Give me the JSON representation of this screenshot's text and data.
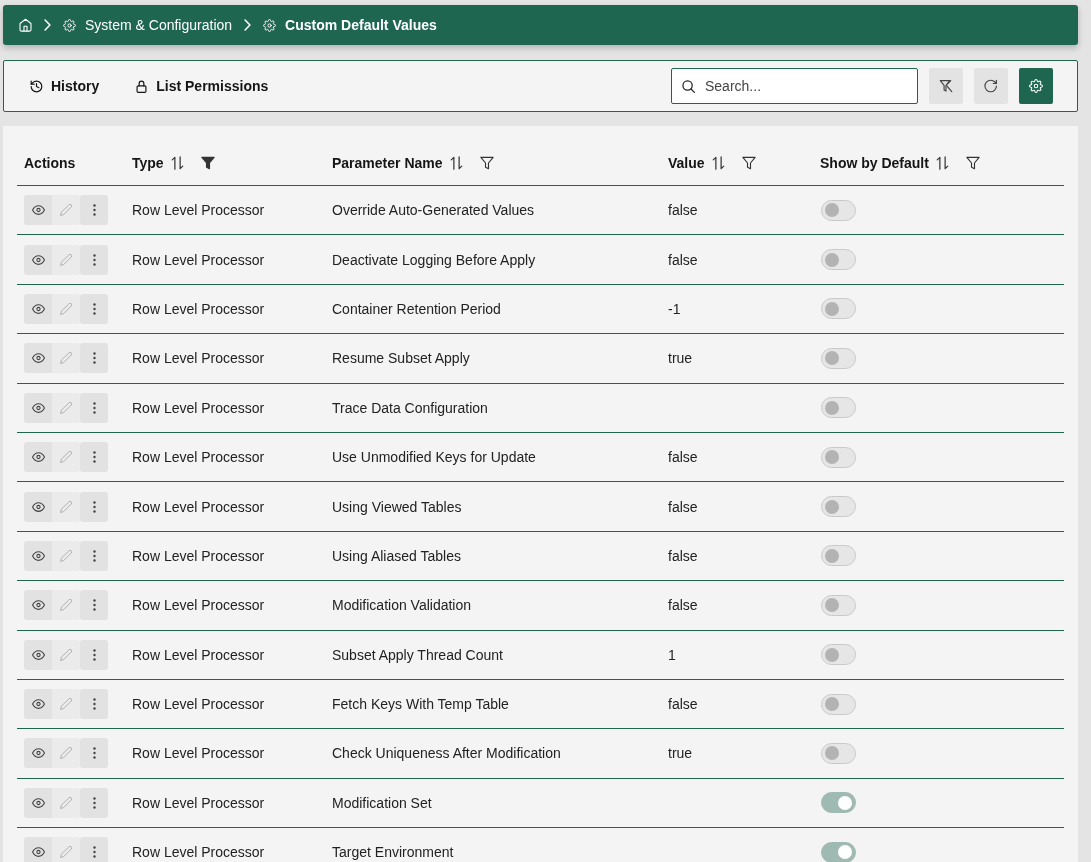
{
  "breadcrumb": {
    "items": [
      {
        "kind": "home",
        "current": false
      },
      {
        "kind": "page",
        "label": "System & Configuration",
        "current": false
      },
      {
        "kind": "page",
        "label": "Custom Default Values",
        "current": true
      }
    ]
  },
  "toolbar": {
    "actions": [
      {
        "kind": "history",
        "label": "History"
      },
      {
        "kind": "permissions",
        "label": "List Permissions"
      }
    ],
    "search": {
      "placeholder": "Search..."
    },
    "buttons": [
      {
        "kind": "clear_filters",
        "primary": false
      },
      {
        "kind": "refresh",
        "primary": false
      },
      {
        "kind": "settings",
        "primary": true
      }
    ]
  },
  "table": {
    "columns": [
      {
        "label": "Actions",
        "kind": "plain"
      },
      {
        "label": "Type",
        "kind": "sortable",
        "filter_active": true
      },
      {
        "label": "Parameter Name",
        "kind": "sortable",
        "filter_active": false
      },
      {
        "label": "Value",
        "kind": "sortable",
        "filter_active": false
      },
      {
        "label": "Show by Default",
        "kind": "sortable",
        "filter_active": false
      }
    ],
    "row_actions": [
      {
        "kind": "view",
        "disabled": false
      },
      {
        "kind": "edit",
        "disabled": true
      },
      {
        "kind": "more",
        "disabled": false
      }
    ],
    "rows": [
      {
        "type": "Row Level Processor",
        "parameter": "Override Auto-Generated Values",
        "value": "false",
        "show_by_default": false
      },
      {
        "type": "Row Level Processor",
        "parameter": "Deactivate Logging Before Apply",
        "value": "false",
        "show_by_default": false
      },
      {
        "type": "Row Level Processor",
        "parameter": "Container Retention Period",
        "value": "-1",
        "show_by_default": false
      },
      {
        "type": "Row Level Processor",
        "parameter": "Resume Subset Apply",
        "value": "true",
        "show_by_default": false
      },
      {
        "type": "Row Level Processor",
        "parameter": "Trace Data Configuration",
        "show_by_default": false
      },
      {
        "type": "Row Level Processor",
        "parameter": "Use Unmodified Keys for Update",
        "value": "false",
        "show_by_default": false
      },
      {
        "type": "Row Level Processor",
        "parameter": "Using Viewed Tables",
        "value": "false",
        "show_by_default": false
      },
      {
        "type": "Row Level Processor",
        "parameter": "Using Aliased Tables",
        "value": "false",
        "show_by_default": false
      },
      {
        "type": "Row Level Processor",
        "parameter": "Modification Validation",
        "value": "false",
        "show_by_default": false
      },
      {
        "type": "Row Level Processor",
        "parameter": "Subset Apply Thread Count",
        "value": "1",
        "show_by_default": false
      },
      {
        "type": "Row Level Processor",
        "parameter": "Fetch Keys With Temp Table",
        "value": "false",
        "show_by_default": false
      },
      {
        "type": "Row Level Processor",
        "parameter": "Check Uniqueness After Modification",
        "value": "true",
        "show_by_default": false
      },
      {
        "type": "Row Level Processor",
        "parameter": "Modification Set",
        "show_by_default": true
      },
      {
        "type": "Row Level Processor",
        "parameter": "Target Environment",
        "show_by_default": true
      }
    ]
  }
}
